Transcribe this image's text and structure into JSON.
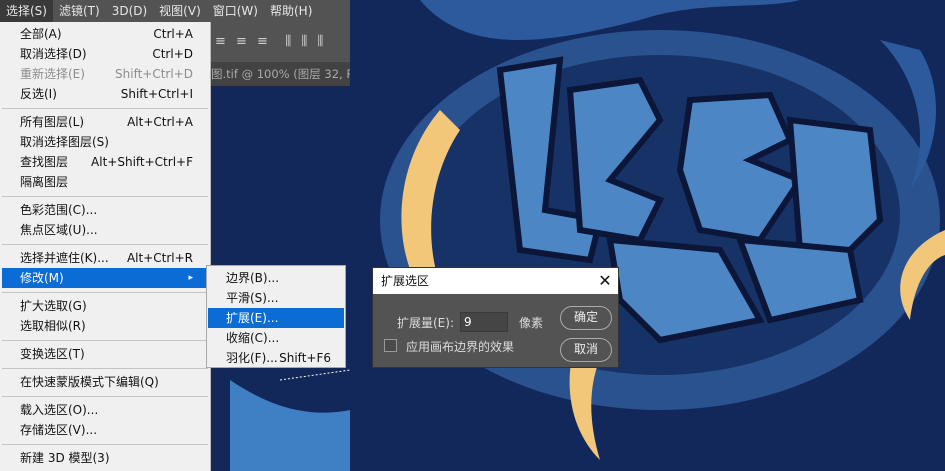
{
  "menubar": [
    "选择(S)",
    "滤镜(T)",
    "3D(D)",
    "视图(V)",
    "窗口(W)",
    "帮助(H)"
  ],
  "toolbar_icons": "align-distribute-icons",
  "doc_tab": "图.tif @ 100% (图层 32, RG",
  "menu": [
    {
      "label": "全部(A)",
      "shortcut": "Ctrl+A"
    },
    {
      "label": "取消选择(D)",
      "shortcut": "Ctrl+D"
    },
    {
      "label": "重新选择(E)",
      "shortcut": "Shift+Ctrl+D",
      "disabled": true
    },
    {
      "label": "反选(I)",
      "shortcut": "Shift+Ctrl+I"
    },
    {
      "sep": true
    },
    {
      "label": "所有图层(L)",
      "shortcut": "Alt+Ctrl+A"
    },
    {
      "label": "取消选择图层(S)",
      "shortcut": ""
    },
    {
      "label": "查找图层",
      "shortcut": "Alt+Shift+Ctrl+F"
    },
    {
      "label": "隔离图层",
      "shortcut": ""
    },
    {
      "sep": true
    },
    {
      "label": "色彩范围(C)...",
      "shortcut": ""
    },
    {
      "label": "焦点区域(U)...",
      "shortcut": ""
    },
    {
      "sep": true
    },
    {
      "label": "选择并遮住(K)...",
      "shortcut": "Alt+Ctrl+R"
    },
    {
      "label": "修改(M)",
      "shortcut": "▸",
      "highlight": true
    },
    {
      "sep": true
    },
    {
      "label": "扩大选取(G)",
      "shortcut": ""
    },
    {
      "label": "选取相似(R)",
      "shortcut": ""
    },
    {
      "sep": true
    },
    {
      "label": "变换选区(T)",
      "shortcut": ""
    },
    {
      "sep": true
    },
    {
      "label": "在快速蒙版模式下编辑(Q)",
      "shortcut": ""
    },
    {
      "sep": true
    },
    {
      "label": "载入选区(O)...",
      "shortcut": ""
    },
    {
      "label": "存储选区(V)...",
      "shortcut": ""
    },
    {
      "sep": true
    },
    {
      "label": "新建 3D 模型(3)",
      "shortcut": ""
    }
  ],
  "submenu": [
    {
      "label": "边界(B)...",
      "shortcut": ""
    },
    {
      "label": "平滑(S)...",
      "shortcut": ""
    },
    {
      "label": "扩展(E)...",
      "shortcut": "",
      "highlight": true
    },
    {
      "label": "收缩(C)...",
      "shortcut": ""
    },
    {
      "label": "羽化(F)...",
      "shortcut": "Shift+F6"
    }
  ],
  "dialog": {
    "title": "扩展选区",
    "close": "✕",
    "amount_label": "扩展量(E):",
    "amount_value": "9",
    "unit": "像素",
    "checkbox_label": "应用画布边界的效果",
    "ok": "确定",
    "cancel": "取消"
  },
  "colors": {
    "highlight": "#0a6cd4",
    "canvas": "#0e1f4a",
    "accent_gold": "#f3c77a"
  }
}
